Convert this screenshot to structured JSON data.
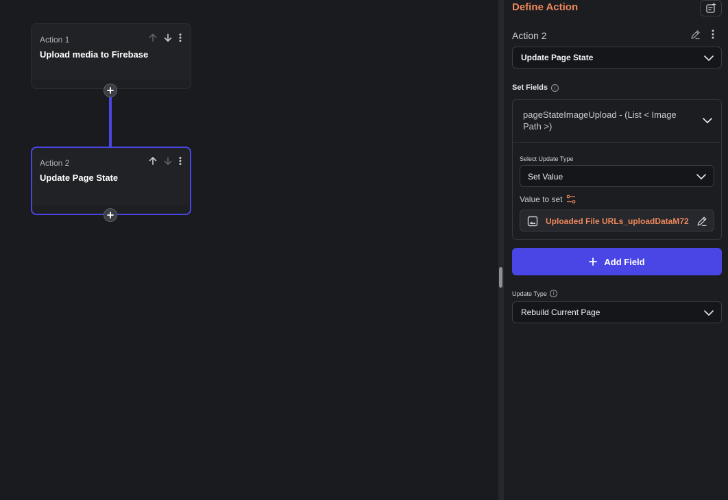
{
  "canvas": {
    "actions": [
      {
        "number_label": "Action 1",
        "title": "Upload media to Firebase"
      },
      {
        "number_label": "Action 2",
        "title": "Update Page State"
      }
    ]
  },
  "panel": {
    "title": "Define Action",
    "action_name": "Action 2",
    "action_type": "Update Page State",
    "set_fields_label": "Set Fields",
    "field": {
      "name": "pageStateImageUpload - (List < Image Path >)",
      "select_update_type_label": "Select Update Type",
      "update_type_value": "Set Value",
      "value_to_set_label": "Value to set",
      "value": "Uploaded File URLs_uploadDataM72"
    },
    "add_field_label": "Add Field",
    "update_type_label": "Update Type",
    "update_type_value": "Rebuild Current Page"
  },
  "colors": {
    "accent": "#4a46e6",
    "title_orange": "#f0885c",
    "background": "#1a1b1e"
  }
}
